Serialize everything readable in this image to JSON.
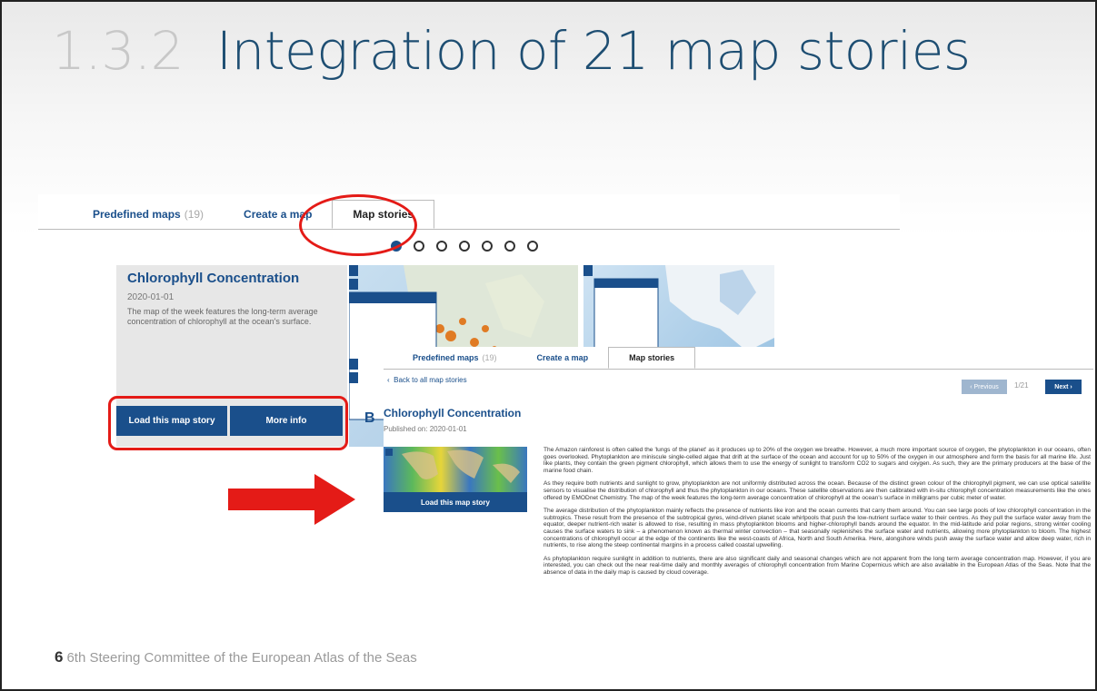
{
  "slide": {
    "title_num": "1.3.2",
    "title_text": "Integration of 21 map stories",
    "footer_num": "6",
    "footer_text": "6th Steering Committee of the European Atlas of the Seas"
  },
  "back_panel": {
    "tabs": [
      {
        "label": "Predefined maps",
        "count": "(19)"
      },
      {
        "label": "Create a map"
      },
      {
        "label": "Map stories"
      }
    ],
    "carousel_dots": 7,
    "card": {
      "title": "Chlorophyll Concentration",
      "date": "2020-01-01",
      "description": "The map of the week features the long-term average concentration of chlorophyll at the ocean's surface.",
      "load_button": "Load this map story",
      "more_button": "More info"
    },
    "next_card_initial": "B"
  },
  "front_panel": {
    "tabs": [
      {
        "label": "Predefined maps",
        "count": "(19)"
      },
      {
        "label": "Create a map"
      },
      {
        "label": "Map stories"
      }
    ],
    "back_link": "Back to all map stories",
    "pager": {
      "previous": "Previous",
      "position": "1/21",
      "next": "Next"
    },
    "title": "Chlorophyll Concentration",
    "published": "Published on: 2020-01-01",
    "load_button": "Load this map story",
    "paragraphs": [
      "The Amazon rainforest is often called the 'lungs of the planet' as it produces up to 20% of the oxygen we breathe. However, a much more important source of oxygen, the phytoplankton in our oceans, often goes overlooked. Phytoplankton are miniscule single-celled algae that drift at the surface of the ocean and account for up to 50% of the oxygen in our atmosphere and form the basis for all marine life. Just like plants, they contain the green pigment chlorophyll, which allows them to use the energy of sunlight to transform CO2 to sugars and oxygen. As such, they are the primary producers at the base of the marine food chain.",
      "As they require both nutrients and sunlight to grow, phytoplankton are not uniformly distributed across the ocean. Because of the distinct green colour of the chlorophyll pigment, we can use optical satellite sensors to visualise the distribution of chlorophyll and thus the phytoplankton in our oceans. These satellite observations are then calibrated with in-situ chlorophyll concentration measurements like the ones offered by EMODnet Chemistry. The map of the week features the long-term average concentration of chlorophyll at the ocean's surface in milligrams per cubic meter of water.",
      "The average distribution of the phytoplankton mainly reflects the presence of nutrients like iron and the ocean currents that carry them around. You can see large pools of low chlorophyll concentration in the subtropics. These result from the presence of the subtropical gyres, wind-driven planet scale whirlpools that push the low-nutrient surface water to their centres. As they pull the surface water away from the equator, deeper nutrient-rich water is allowed to rise, resulting in mass phytoplankton blooms and higher-chlorophyll bands around the equator. In the mid-latitude and polar regions, strong winter cooling causes the surface waters to sink – a phenomenon known as thermal winter convection – that seasonally replenishes the surface water and nutrients, allowing more phytoplankton to bloom. The highest concentrations of chlorophyll occur at the edge of the continents like the west-coasts of Africa, North and South Amerika. Here, alongshore winds push away the surface water and allow deep water, rich in nutrients, to rise along the steep continental margins in a process called coastal upwelling.",
      "As phytoplankton require sunlight in addition to nutrients, there are also significant daily and seasonal changes which are not apparent from the long term average concentration map. However, if you are interested, you can check out the near real-time daily and monthly averages of chlorophyll concentration from Marine Copernicus which are also available in the European Atlas of the Seas. Note that the absence of data in the daily map is caused by cloud coverage."
    ]
  },
  "colors": {
    "highlight": "#e41b17",
    "brand": "#1a4f8b"
  }
}
